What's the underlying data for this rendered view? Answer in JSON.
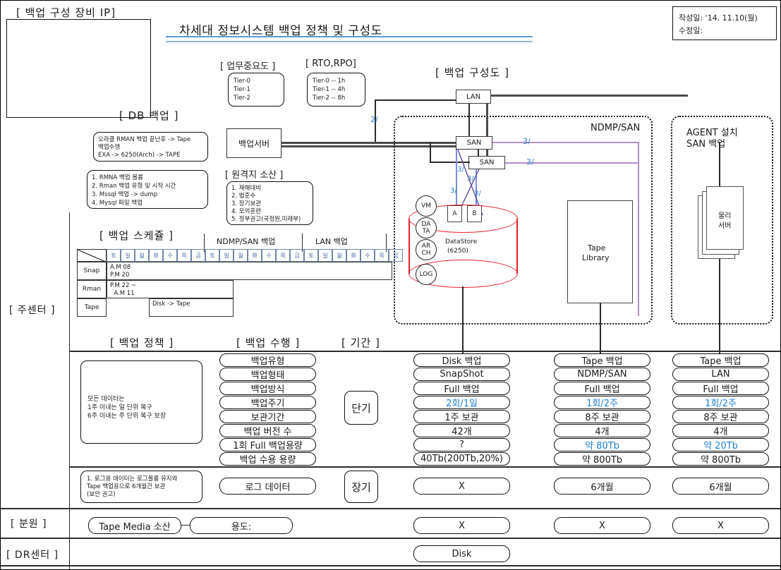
{
  "document": {
    "title": "차세대 정보시스템 백업 정책 및 구성도",
    "date_label": "작성일: '14. 11.10(월)",
    "revision_label": "수정일:"
  },
  "sections": {
    "equipment_ip": "[ 백업 구성 장비 IP]",
    "db_backup": "[ DB 백업 ]",
    "business_priority": "[ 업무중요도 ]",
    "rto_rpo": "[ RTO,RPO]",
    "backup_diagram": "[ 백업 구성도 ]",
    "remote_site": "[ 원격지 소산 ]",
    "backup_schedule": "[ 백업 스케쥴 ]",
    "backup_policy": "[ 백업 정책 ]",
    "backup_exec": "[ 백업 수행 ]",
    "period": "[ 기간 ]"
  },
  "left_labels": {
    "main_center": "[ 주센터 ]",
    "branch": "[ 분원 ]",
    "dr_center": "[ DR센터 ]"
  },
  "tier_box": {
    "lines": [
      "Tier-0",
      "Tier-1",
      "Tier-2"
    ]
  },
  "rto_box": {
    "lines": [
      "Tier-0 -- 1h",
      "Tier-1 -- 4h",
      "Tier-2 -- 8h"
    ]
  },
  "db_backup_box1": {
    "lines": [
      "오라클 RMAN 백업 끝난후 -> Tape",
      "백업수행",
      "EXA -> 6250(Arch) -> TAPE"
    ]
  },
  "db_backup_box2": {
    "lines": [
      "1. RMNA 백업 볼륨",
      "2. Rman 백업 유형 및 시작 시간",
      "3. Mssql 백업 -> dump",
      "4. Mysql 파일 백업"
    ]
  },
  "remote_site_box": {
    "lines": [
      "1. 재해대비",
      "2. 법준수",
      "3. 장기보관",
      "4. 모의훈련",
      "5. 정부권고(국정원,미래부)"
    ]
  },
  "policy_box": {
    "lines": [
      "모든 데이터는",
      " 1주 이내는 일 단위 복구",
      " 6주 이내는 주 단위 복구 보장"
    ]
  },
  "log_policy_box": {
    "lines": [
      "1. 로그용 데이터는 로그볼륨 유지와",
      "    Tape 백업용으로 6개월간 보관",
      "    (보안 권고)"
    ]
  },
  "diagram": {
    "lan_label": "LAN",
    "backup_server": "백업서버",
    "san_1": "SAN",
    "san_2": "SAN",
    "ndmp_san_label": "NDMP/SAN",
    "agent_label_line1": "AGENT 설치",
    "agent_label_line2": "SAN 백업",
    "physical_server_line1": "물리",
    "physical_server_line2": "서버",
    "tape_library_line1": "Tape",
    "tape_library_line2": "Library",
    "datastore_line1": "DataStore",
    "datastore_line2": "(6250)",
    "node_a": "A",
    "node_b": "B",
    "circles": [
      "VM",
      "DA\nTA",
      "AR\nCH",
      "LOG"
    ],
    "link_labels": [
      "2/",
      "3/",
      "3/",
      "3/",
      "3/",
      "3/",
      "3/"
    ]
  },
  "schedule": {
    "group_labels": [
      "NDMP/SAN 백업",
      "LAN 백업"
    ],
    "days": [
      "토",
      "일",
      "월",
      "화",
      "수",
      "목",
      "금"
    ],
    "weeks": 3,
    "rows": [
      {
        "label": "Snap",
        "value": "A.M 08\nP.M 20"
      },
      {
        "label": "Rman",
        "value": "P.M 22 ~\n  A.M 11"
      },
      {
        "label": "Tape",
        "value": "Disk -> Tape"
      }
    ]
  },
  "table": {
    "exec_rows": [
      "백업유형",
      "백업형태",
      "백업방식",
      "백업주기",
      "보관기간",
      "백업 버전 수",
      "1회 Full 백업용량",
      "백업 수용 용량"
    ],
    "period_short": "단기",
    "period_long": "장기",
    "log_row_label": "로그 데이터",
    "columns": [
      {
        "name": "disk",
        "values": [
          "Disk 백업",
          "SnapShot",
          "Full 백업",
          "2회/1일",
          "1주 보관",
          "42개",
          "?",
          "40Tb(200Tb,20%)"
        ],
        "highlight": [
          false,
          false,
          false,
          true,
          false,
          false,
          false,
          false
        ],
        "log_value": "X",
        "branch_value": "X",
        "dr_value": "Disk"
      },
      {
        "name": "tape-ndmp",
        "values": [
          "Tape 백업",
          "NDMP/SAN",
          "Full 백업",
          "1회/2주",
          "8주 보관",
          "4개",
          "약 80Tb",
          "약 800Tb"
        ],
        "highlight": [
          false,
          false,
          false,
          true,
          false,
          false,
          true,
          false
        ],
        "log_value": "6개월",
        "branch_value": "X",
        "dr_value": ""
      },
      {
        "name": "tape-lan",
        "values": [
          "Tape 백업",
          "LAN",
          "Full 백업",
          "1회/2주",
          "8주 보관",
          "4개",
          "약 20Tb",
          "약 800Tb"
        ],
        "highlight": [
          false,
          false,
          false,
          true,
          false,
          false,
          true,
          false
        ],
        "log_value": "6개월",
        "branch_value": "X",
        "dr_value": ""
      }
    ],
    "branch_items": [
      "Tape Media 소산",
      "용도:"
    ]
  },
  "colors": {
    "accent_blue": "#1d7fd0",
    "title_rule": "#5b9bd5",
    "cylinder_red": "#e8202a",
    "purple_link": "#b08cd0"
  }
}
